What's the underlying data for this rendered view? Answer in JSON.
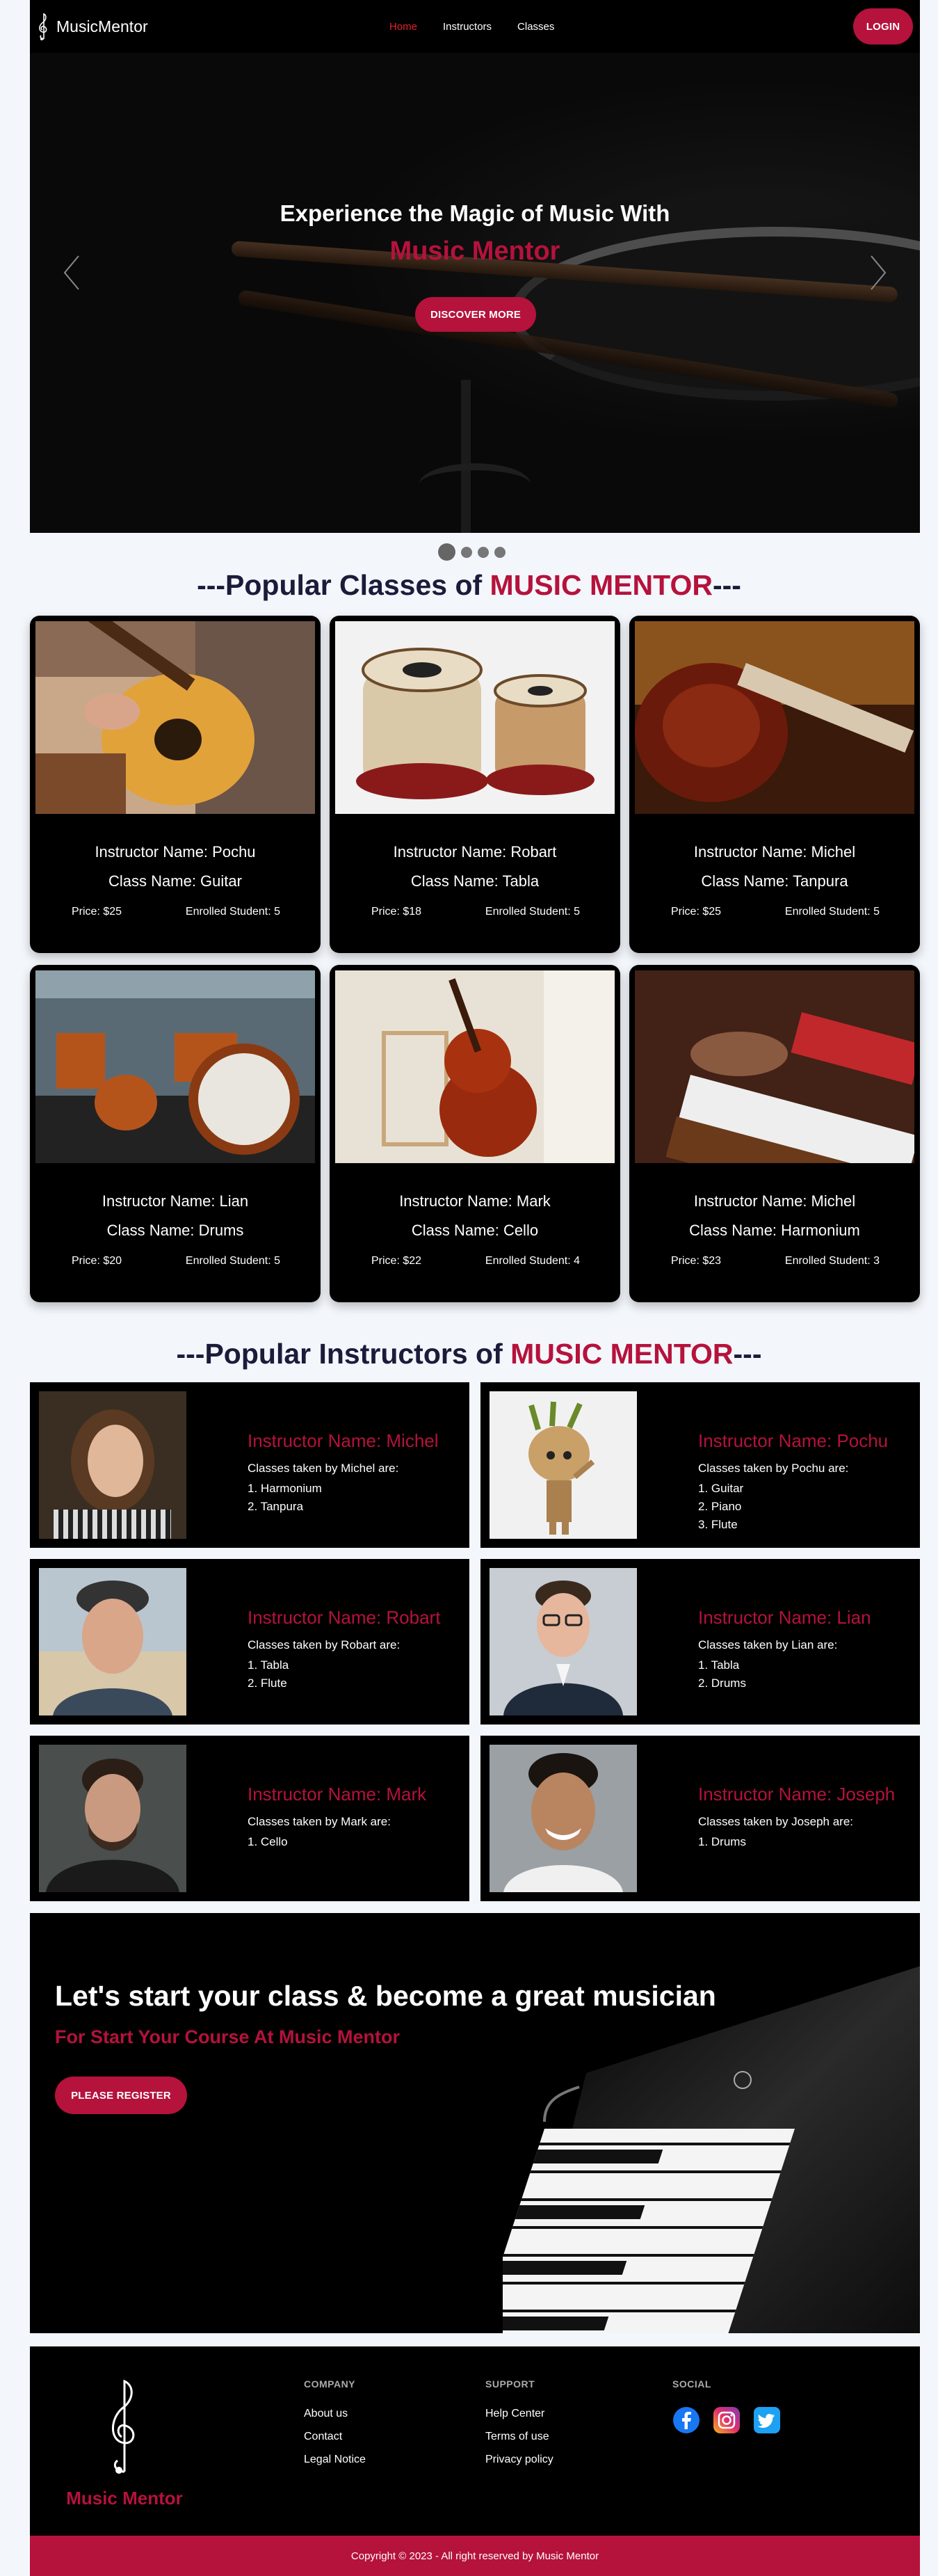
{
  "nav": {
    "logo_text": "MusicMentor",
    "links": [
      "Home",
      "Instructors",
      "Classes"
    ],
    "active_link": "Home",
    "login_label": "LOGIN"
  },
  "hero": {
    "title": "Experience the Magic of Music With",
    "subtitle": "Music Mentor",
    "button": "DISCOVER MORE",
    "slide_count": 4,
    "active_slide": 1
  },
  "popular_classes": {
    "title_prefix": "---Popular Classes of ",
    "title_highlight": "MUSIC MENTOR",
    "title_suffix": "---",
    "items": [
      {
        "instructor": "Instructor Name: Pochu",
        "class": "Class Name: Guitar",
        "price": "Price: $25",
        "enrolled": "Enrolled Student: 5",
        "icon": "guitar-photo"
      },
      {
        "instructor": "Instructor Name: Robart",
        "class": "Class Name: Tabla",
        "price": "Price: $18",
        "enrolled": "Enrolled Student: 5",
        "icon": "tabla-photo"
      },
      {
        "instructor": "Instructor Name: Michel",
        "class": "Class Name: Tanpura",
        "price": "Price: $25",
        "enrolled": "Enrolled Student: 5",
        "icon": "tanpura-photo"
      },
      {
        "instructor": "Instructor Name: Lian",
        "class": "Class Name: Drums",
        "price": "Price: $20",
        "enrolled": "Enrolled Student: 5",
        "icon": "drums-photo"
      },
      {
        "instructor": "Instructor Name: Mark",
        "class": "Class Name: Cello",
        "price": "Price: $22",
        "enrolled": "Enrolled Student: 4",
        "icon": "cello-photo"
      },
      {
        "instructor": "Instructor Name: Michel",
        "class": "Class Name: Harmonium",
        "price": "Price: $23",
        "enrolled": "Enrolled Student: 3",
        "icon": "harmonium-photo"
      }
    ]
  },
  "popular_instructors": {
    "title_prefix": "---Popular Instructors of ",
    "title_highlight": "MUSIC MENTOR",
    "title_suffix": "---",
    "items": [
      {
        "name": "Instructor Name: Michel",
        "lead": "Classes taken by Michel are:",
        "classes": [
          "1. Harmonium",
          "2. Tanpura"
        ]
      },
      {
        "name": "Instructor Name: Pochu",
        "lead": "Classes taken by Pochu are:",
        "classes": [
          "1. Guitar",
          "2. Piano",
          "3. Flute"
        ]
      },
      {
        "name": "Instructor Name: Robart",
        "lead": "Classes taken by Robart are:",
        "classes": [
          "1. Tabla",
          "2. Flute"
        ]
      },
      {
        "name": "Instructor Name: Lian",
        "lead": "Classes taken by Lian are:",
        "classes": [
          "1. Tabla",
          "2. Drums"
        ]
      },
      {
        "name": "Instructor Name: Mark",
        "lead": "Classes taken by Mark are:",
        "classes": [
          "1. Cello"
        ]
      },
      {
        "name": "Instructor Name: Joseph",
        "lead": "Classes taken by Joseph are:",
        "classes": [
          "1. Drums"
        ]
      }
    ]
  },
  "cta": {
    "title": "Let's start your class & become a great musician",
    "subtitle": "For Start Your Course At Music Mentor",
    "button": "PLEASE REGISTER"
  },
  "footer": {
    "brand_name": "Music Mentor",
    "company": {
      "heading": "COMPANY",
      "links": [
        "About us",
        "Contact",
        "Legal Notice"
      ]
    },
    "support": {
      "heading": "SUPPORT",
      "links": [
        "Help Center",
        "Terms of use",
        "Privacy policy"
      ]
    },
    "social": {
      "heading": "SOCIAL",
      "icons": [
        "facebook-icon",
        "instagram-icon",
        "twitter-icon"
      ]
    },
    "copyright": "Copyright © 2023 - All right reserved by Music Mentor"
  },
  "colors": {
    "accent": "#b5123c",
    "active_nav": "#e5202f",
    "dark": "#000000",
    "page_bg": "#f3f6fb"
  }
}
